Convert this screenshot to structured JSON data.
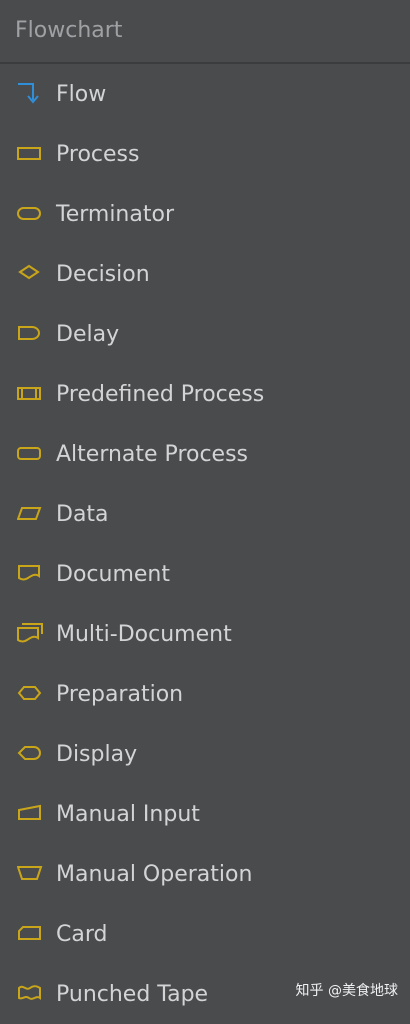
{
  "panel": {
    "title": "Flowchart"
  },
  "colors": {
    "background": "#4a4b4d",
    "icon_stroke": "#c9a51a",
    "flow_arrow": "#2f8fd8",
    "text": "#d3d4d6",
    "header_text": "#9fa1a4"
  },
  "items": [
    {
      "label": "Flow",
      "icon": "flow-arrow-icon"
    },
    {
      "label": "Process",
      "icon": "process-rectangle-icon"
    },
    {
      "label": "Terminator",
      "icon": "terminator-icon"
    },
    {
      "label": "Decision",
      "icon": "decision-diamond-icon"
    },
    {
      "label": "Delay",
      "icon": "delay-icon"
    },
    {
      "label": "Predefined Process",
      "icon": "predefined-process-icon"
    },
    {
      "label": "Alternate Process",
      "icon": "alternate-process-icon"
    },
    {
      "label": "Data",
      "icon": "data-parallelogram-icon"
    },
    {
      "label": "Document",
      "icon": "document-icon"
    },
    {
      "label": "Multi-Document",
      "icon": "multi-document-icon"
    },
    {
      "label": "Preparation",
      "icon": "preparation-hexagon-icon"
    },
    {
      "label": "Display",
      "icon": "display-icon"
    },
    {
      "label": "Manual Input",
      "icon": "manual-input-icon"
    },
    {
      "label": "Manual Operation",
      "icon": "manual-operation-icon"
    },
    {
      "label": "Card",
      "icon": "card-icon"
    },
    {
      "label": "Punched Tape",
      "icon": "punched-tape-icon"
    }
  ],
  "watermark": {
    "text": "知乎 @美食地球"
  }
}
